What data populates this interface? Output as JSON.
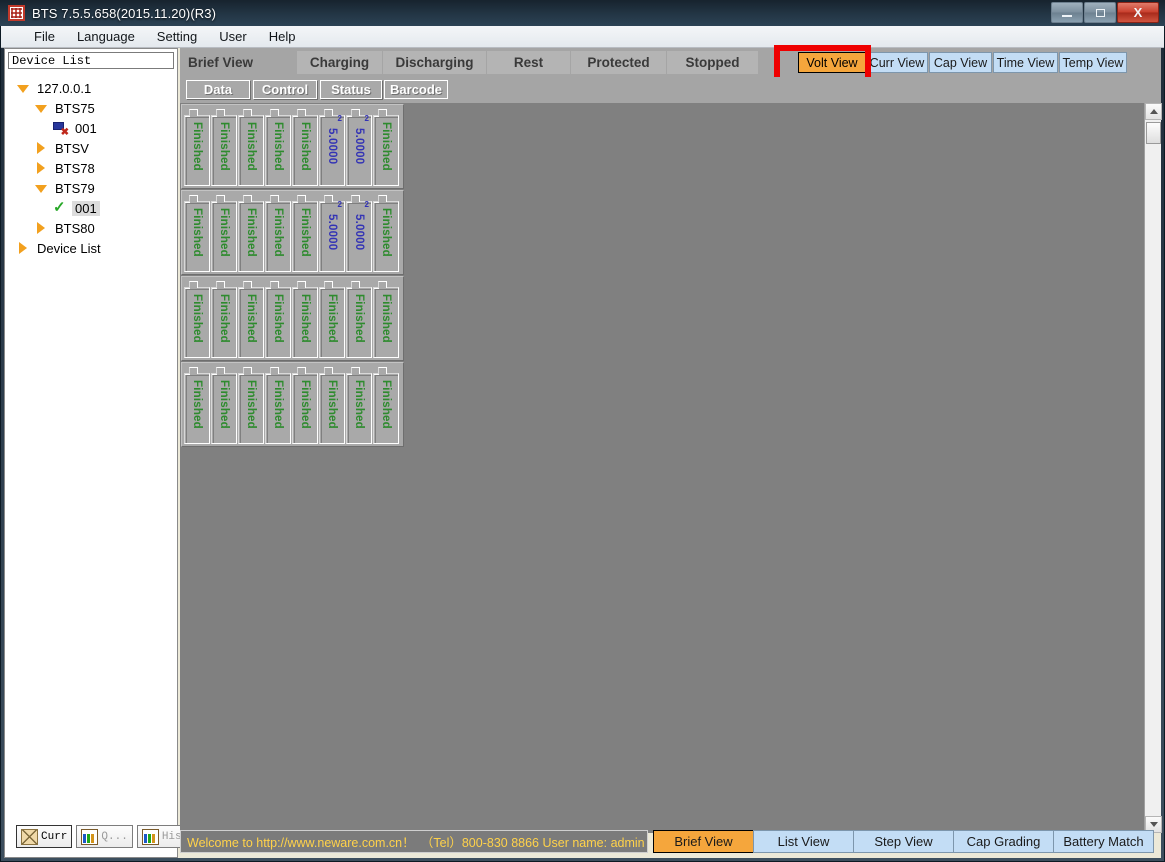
{
  "window": {
    "title": "BTS 7.5.5.658(2015.11.20)(R3)",
    "app_icon": "grid-logo-icon",
    "minimize": "–",
    "maximize": "□",
    "close": "X"
  },
  "menu": {
    "items": [
      {
        "label": "File",
        "accel": "F"
      },
      {
        "label": "Language",
        "accel": "L"
      },
      {
        "label": "Setting",
        "accel": "S"
      },
      {
        "label": "User",
        "accel": "U"
      },
      {
        "label": "Help",
        "accel": "H"
      }
    ]
  },
  "sidebar": {
    "header": "Device List",
    "tree": [
      {
        "label": "127.0.0.1",
        "icon": "triangle-down-icon",
        "indent": 0
      },
      {
        "label": "BTS75",
        "icon": "triangle-down-icon",
        "indent": 1
      },
      {
        "label": "001",
        "icon": "device-offline-icon",
        "indent": 2
      },
      {
        "label": "BTSV",
        "icon": "triangle-right-icon",
        "indent": 1
      },
      {
        "label": "BTS78",
        "icon": "triangle-right-icon",
        "indent": 1
      },
      {
        "label": "BTS79",
        "icon": "triangle-down-icon",
        "indent": 1
      },
      {
        "label": "001",
        "icon": "check-icon",
        "indent": 2,
        "selected": true
      },
      {
        "label": "BTS80",
        "icon": "triangle-right-icon",
        "indent": 1
      },
      {
        "label": "Device List",
        "icon": "triangle-right-icon",
        "indent": 0
      }
    ],
    "buttons": [
      {
        "label": "Curr",
        "icon": "envelope-icon",
        "active": true
      },
      {
        "label": "Q...",
        "icon": "chart-icon",
        "active": false
      },
      {
        "label": "Hist",
        "icon": "chart-icon",
        "active": false
      }
    ]
  },
  "view_bar": {
    "title": "Brief View",
    "status_tabs": [
      "Charging",
      "Discharging",
      "Rest",
      "Protected",
      "Stopped"
    ],
    "view_buttons": [
      {
        "label": "Volt View",
        "selected": true
      },
      {
        "label": "Curr View",
        "selected": false
      },
      {
        "label": "Cap View",
        "selected": false
      },
      {
        "label": "Time View",
        "selected": false
      },
      {
        "label": "Temp View",
        "selected": false
      }
    ],
    "overflow_icon": "double-chevron-right-icon",
    "annotation_color": "#ef0000",
    "annotation_target": "Volt View"
  },
  "sub_bar": {
    "tabs": [
      "Data",
      "Control",
      "Status",
      "Barcode"
    ]
  },
  "cells": {
    "finished_label": "Finished",
    "superscript": "2",
    "rows": [
      [
        "Finished",
        "Finished",
        "Finished",
        "Finished",
        "Finished",
        "5.0000",
        "5.0000",
        "Finished"
      ],
      [
        "Finished",
        "Finished",
        "Finished",
        "Finished",
        "Finished",
        "5.0000",
        "5.0000",
        "Finished"
      ],
      [
        "Finished",
        "Finished",
        "Finished",
        "Finished",
        "Finished",
        "Finished",
        "Finished",
        "Finished"
      ],
      [
        "Finished",
        "Finished",
        "Finished",
        "Finished",
        "Finished",
        "Finished",
        "Finished",
        "Finished"
      ]
    ]
  },
  "status_bar": {
    "message": "Welcome to http://www.neware.com.cn！　（Tel）800-830 8866  User name: admin"
  },
  "bottom_buttons": [
    {
      "label": "Brief View",
      "selected": true
    },
    {
      "label": "List View",
      "selected": false
    },
    {
      "label": "Step View",
      "selected": false
    },
    {
      "label": "Cap Grading",
      "selected": false
    },
    {
      "label": "Battery Match",
      "selected": false
    }
  ],
  "colors": {
    "accent_orange": "#f5a63c",
    "button_blue": "#c3ddf5",
    "status_yellow": "#ffd24a",
    "finished_green": "#2e8b2e",
    "value_blue": "#3333b5",
    "annotation_red": "#ef0000"
  }
}
